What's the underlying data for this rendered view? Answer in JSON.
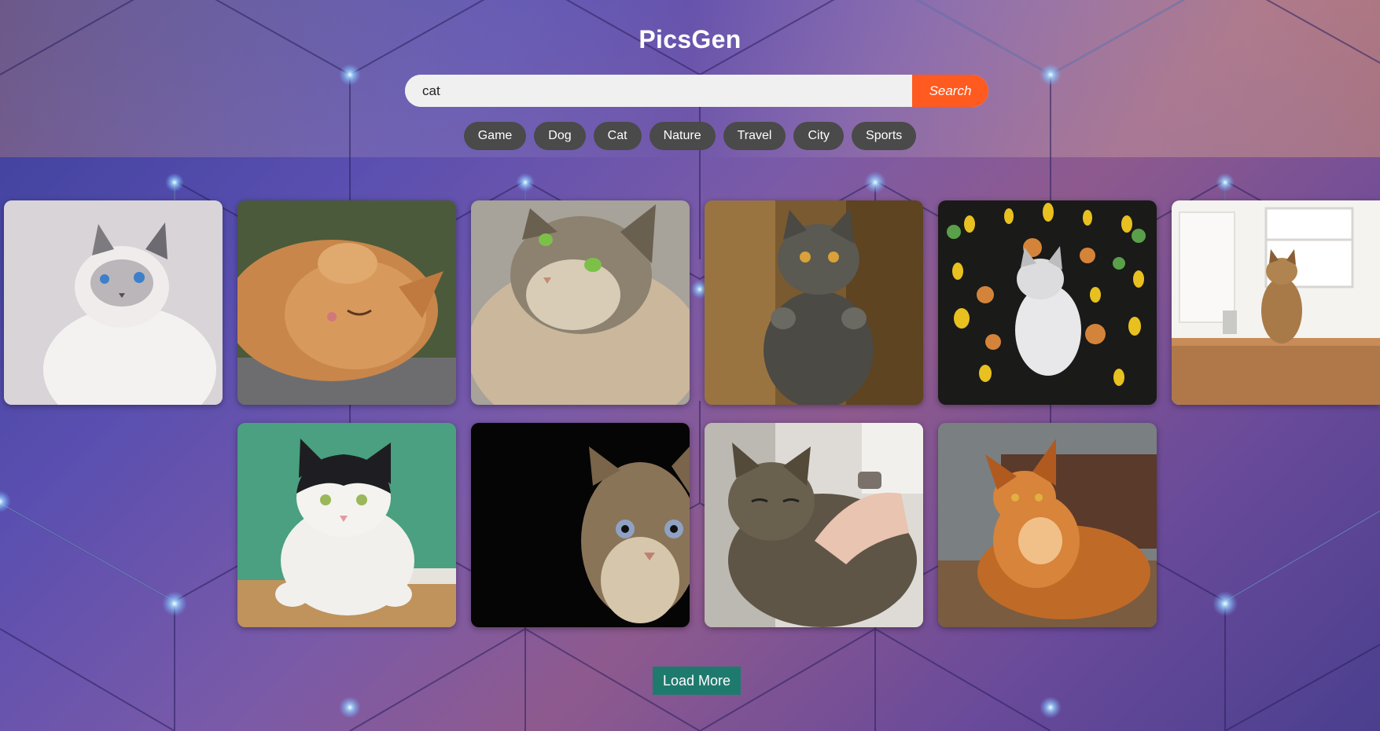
{
  "app": {
    "title": "PicsGen"
  },
  "search": {
    "value": "cat",
    "button_label": "Search"
  },
  "tags": [
    "Game",
    "Dog",
    "Cat",
    "Nature",
    "Travel",
    "City",
    "Sports"
  ],
  "results": [
    {
      "subject": "siamese-cat-blue-eyes"
    },
    {
      "subject": "orange-cat-sleeping"
    },
    {
      "subject": "longhair-tabby-green-eyes"
    },
    {
      "subject": "grey-cat-standing"
    },
    {
      "subject": "white-cat-on-autumn-leaves"
    },
    {
      "subject": "tabby-cat-in-kitchen"
    },
    {
      "subject": "black-white-cat-green-wall"
    },
    {
      "subject": "tabby-cat-dark-background"
    },
    {
      "subject": "tabby-cat-with-person"
    },
    {
      "subject": "orange-maine-coon"
    }
  ],
  "load_more": {
    "label": "Load More"
  },
  "colors": {
    "accent": "#ff5a1f",
    "tag_bg": "#4a4a4a",
    "load_more_bg": "#1f7a6e"
  }
}
